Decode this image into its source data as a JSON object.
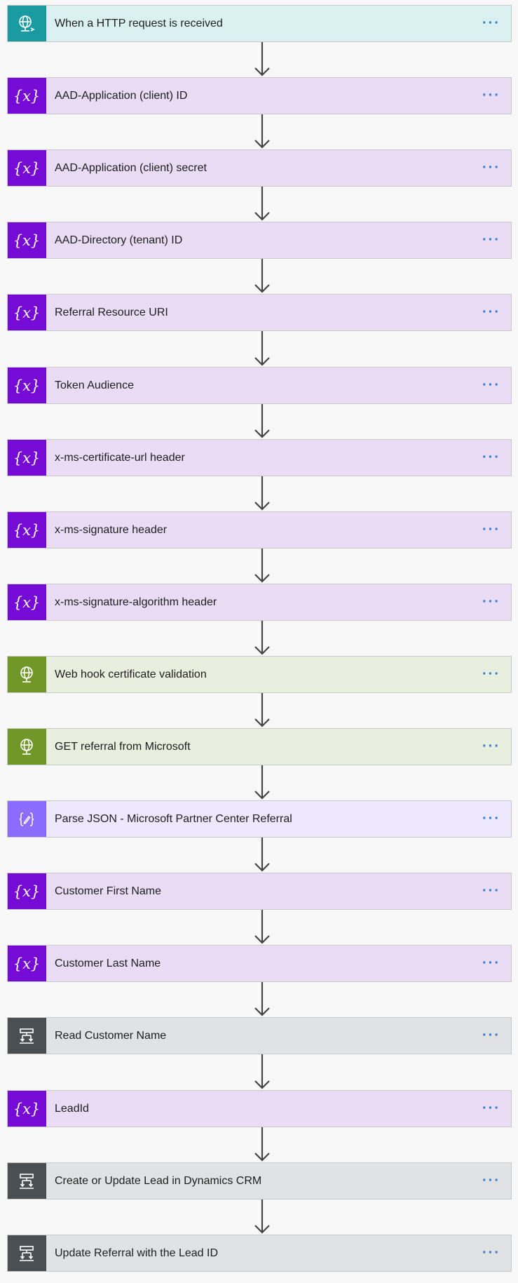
{
  "more_label": "···",
  "steps": [
    {
      "title": "When a HTTP request is received",
      "kind": "trigger",
      "icon": "http-trigger-globe-icon"
    },
    {
      "title": "AAD-Application (client) ID",
      "kind": "variable",
      "icon": "variable-icon"
    },
    {
      "title": "AAD-Application (client) secret",
      "kind": "variable",
      "icon": "variable-icon"
    },
    {
      "title": "AAD-Directory (tenant) ID",
      "kind": "variable",
      "icon": "variable-icon"
    },
    {
      "title": "Referral Resource URI",
      "kind": "variable",
      "icon": "variable-icon"
    },
    {
      "title": "Token Audience",
      "kind": "variable",
      "icon": "variable-icon"
    },
    {
      "title": "x-ms-certificate-url header",
      "kind": "variable",
      "icon": "variable-icon"
    },
    {
      "title": "x-ms-signature header",
      "kind": "variable",
      "icon": "variable-icon"
    },
    {
      "title": "x-ms-signature-algorithm header",
      "kind": "variable",
      "icon": "variable-icon"
    },
    {
      "title": "Web hook certificate validation",
      "kind": "http",
      "icon": "http-globe-icon"
    },
    {
      "title": "GET referral from Microsoft",
      "kind": "http",
      "icon": "http-globe-icon"
    },
    {
      "title": "Parse JSON - Microsoft Partner Center Referral",
      "kind": "parse",
      "icon": "parse-json-icon"
    },
    {
      "title": "Customer First Name",
      "kind": "variable",
      "icon": "variable-icon"
    },
    {
      "title": "Customer Last Name",
      "kind": "variable",
      "icon": "variable-icon"
    },
    {
      "title": "Read Customer Name",
      "kind": "dynamics",
      "icon": "dynamics-crm-icon"
    },
    {
      "title": "LeadId",
      "kind": "variable",
      "icon": "variable-icon"
    },
    {
      "title": "Create or Update Lead in Dynamics CRM",
      "kind": "dynamics",
      "icon": "dynamics-crm-icon"
    },
    {
      "title": "Update Referral with the Lead ID",
      "kind": "dynamics",
      "icon": "dynamics-crm-icon"
    }
  ]
}
